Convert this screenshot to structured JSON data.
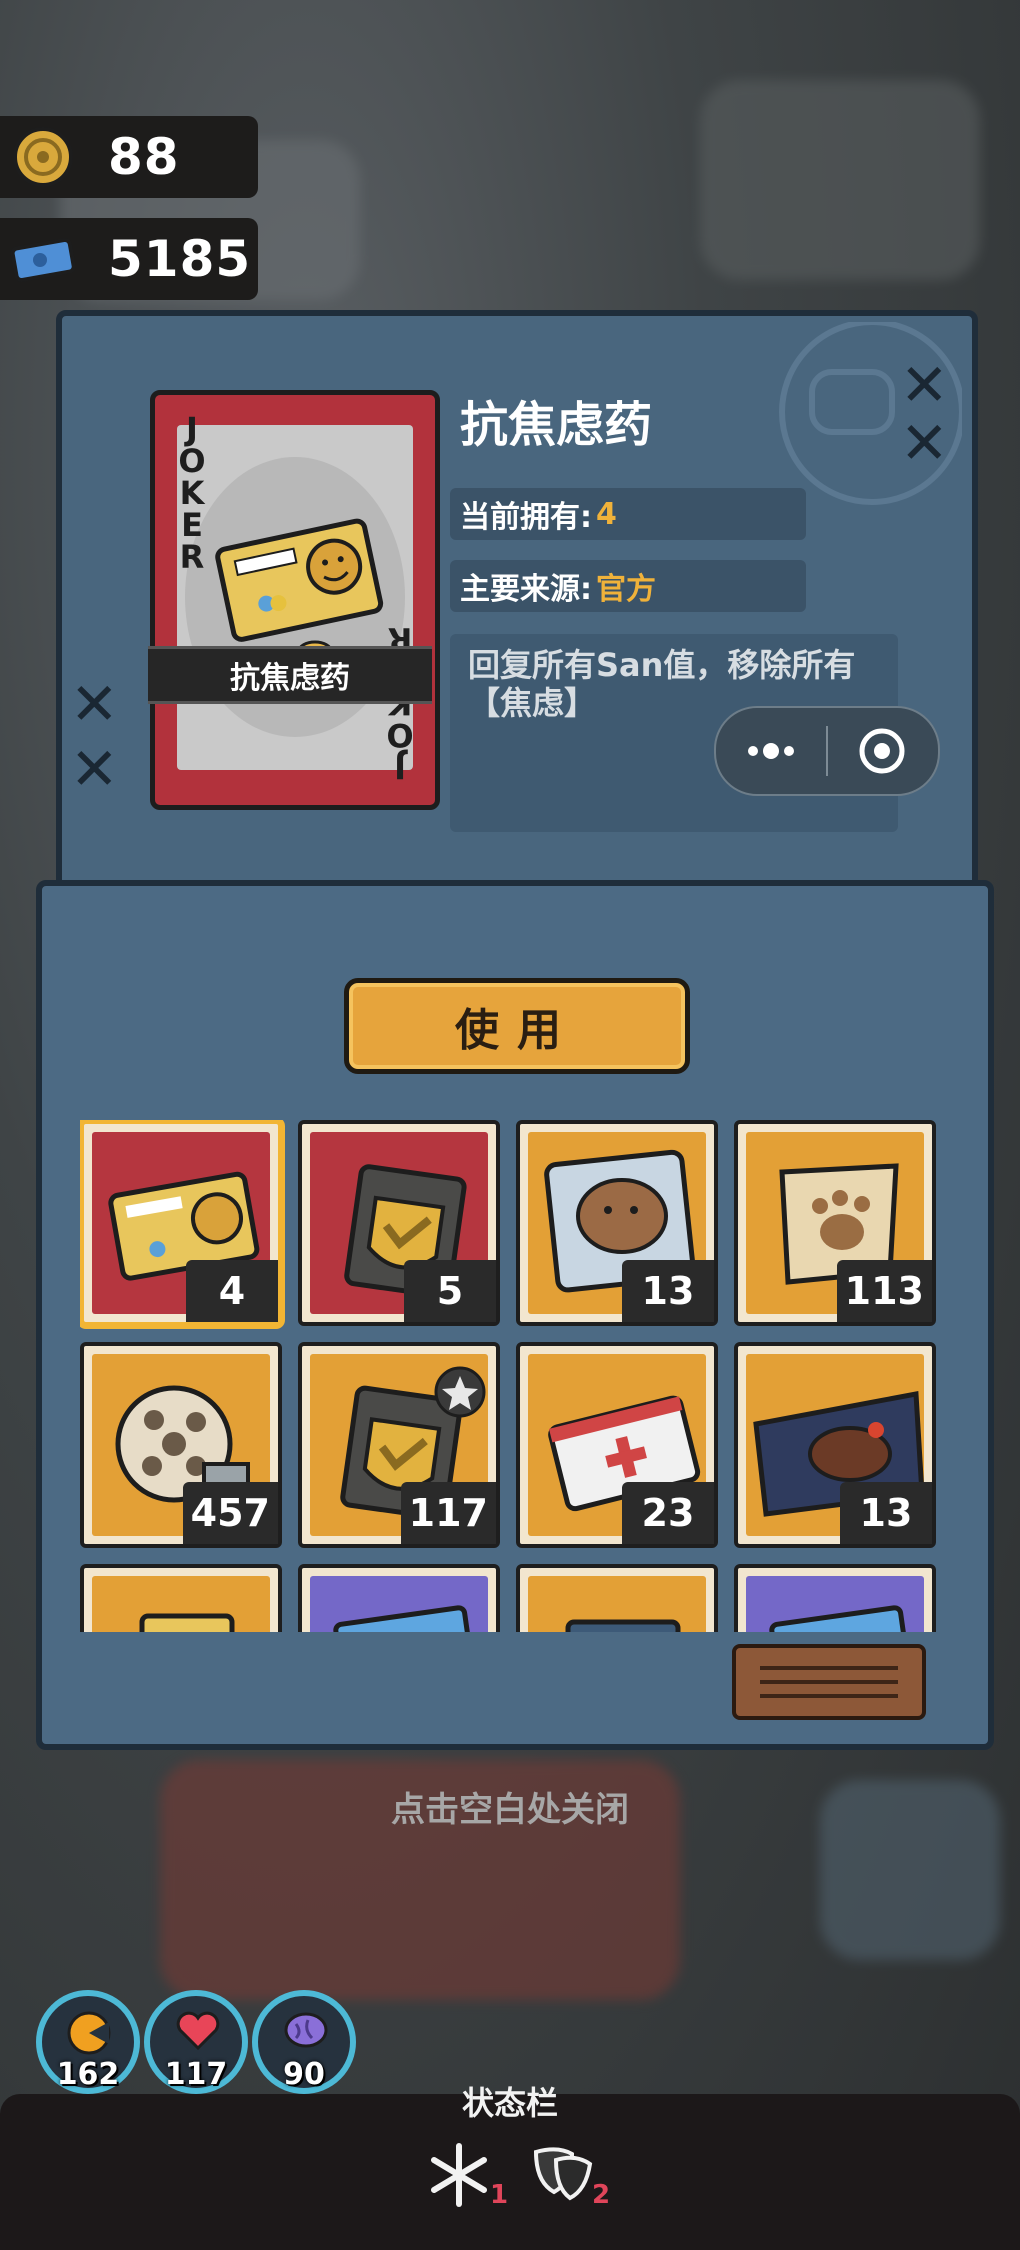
{
  "currency": {
    "coins": "88",
    "tickets": "5185"
  },
  "item": {
    "title": "抗焦虑药",
    "card_label": "抗焦虑药",
    "card_joker": "JOKER",
    "owned_label": "当前拥有:",
    "owned_value": "4",
    "source_label": "主要来源:",
    "source_value": "官方",
    "description": "回复所有San值，移除所有【焦虑】"
  },
  "use_button": "使用",
  "inventory": [
    {
      "name": "anxiety-pills",
      "count": "4",
      "bg": "red",
      "selected": true
    },
    {
      "name": "gold-shield-card",
      "count": "5",
      "bg": "red"
    },
    {
      "name": "capybara-pouch",
      "count": "13",
      "bg": "orange"
    },
    {
      "name": "paw-scroll",
      "count": "113",
      "bg": "orange"
    },
    {
      "name": "film-reel",
      "count": "457",
      "bg": "orange"
    },
    {
      "name": "gold-shield-star",
      "count": "117",
      "bg": "orange"
    },
    {
      "name": "first-aid-card",
      "count": "23",
      "bg": "orange"
    },
    {
      "name": "steak-package",
      "count": "13",
      "bg": "orange"
    },
    {
      "name": "partial-item-1",
      "count": "",
      "bg": "orange"
    },
    {
      "name": "partial-item-2",
      "count": "",
      "bg": "purple"
    },
    {
      "name": "partial-item-3",
      "count": "",
      "bg": "orange"
    },
    {
      "name": "partial-item-4",
      "count": "",
      "bg": "purple"
    }
  ],
  "close_hint": "点击空白处关闭",
  "stats": {
    "hunger": "162",
    "health": "117",
    "sanity": "90"
  },
  "statusbar": {
    "title": "状态栏",
    "cold_count": "1",
    "mask_count": "2"
  },
  "colors": {
    "panel": "#49667e",
    "accent_gold": "#f0b23a",
    "button": "#e6a43c",
    "status_ring": "#4db9d6"
  }
}
